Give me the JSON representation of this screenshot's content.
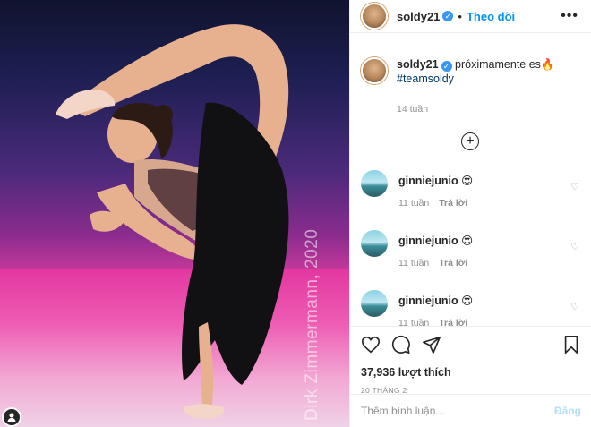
{
  "photo": {
    "alt": "",
    "watermark": "Dirk Zimmermann, 2020"
  },
  "header": {
    "username": "soldy21",
    "verified_icon": "check-icon",
    "follow_label": "Theo dõi",
    "more_icon": "more-horizontal-icon"
  },
  "caption": {
    "username": "soldy21",
    "text": "próximamente es🔥",
    "hashtag": "#teamsoldy",
    "time": "14 tuần"
  },
  "load_more_icon": "plus-circle-icon",
  "comments": [
    {
      "username": "ginniejunio",
      "text": "😍",
      "time": "11 tuần",
      "reply_label": "Trả lời"
    },
    {
      "username": "ginniejunio",
      "text": "😍",
      "time": "11 tuần",
      "reply_label": "Trả lời"
    },
    {
      "username": "ginniejunio",
      "text": "😍",
      "time": "11 tuần",
      "reply_label": "Trả lời"
    }
  ],
  "actions": {
    "like_icon": "heart-icon",
    "comment_icon": "comment-icon",
    "share_icon": "send-icon",
    "save_icon": "bookmark-icon"
  },
  "likes": "37,936 lượt thích",
  "date": "20 tháng 2",
  "add_comment": {
    "placeholder": "Thêm bình luận...",
    "post_label": "Đăng"
  },
  "colors": {
    "accent": "#0095f6",
    "verified": "#3897f0",
    "muted": "#8e8e8e",
    "post_disabled": "#b2dffc"
  }
}
